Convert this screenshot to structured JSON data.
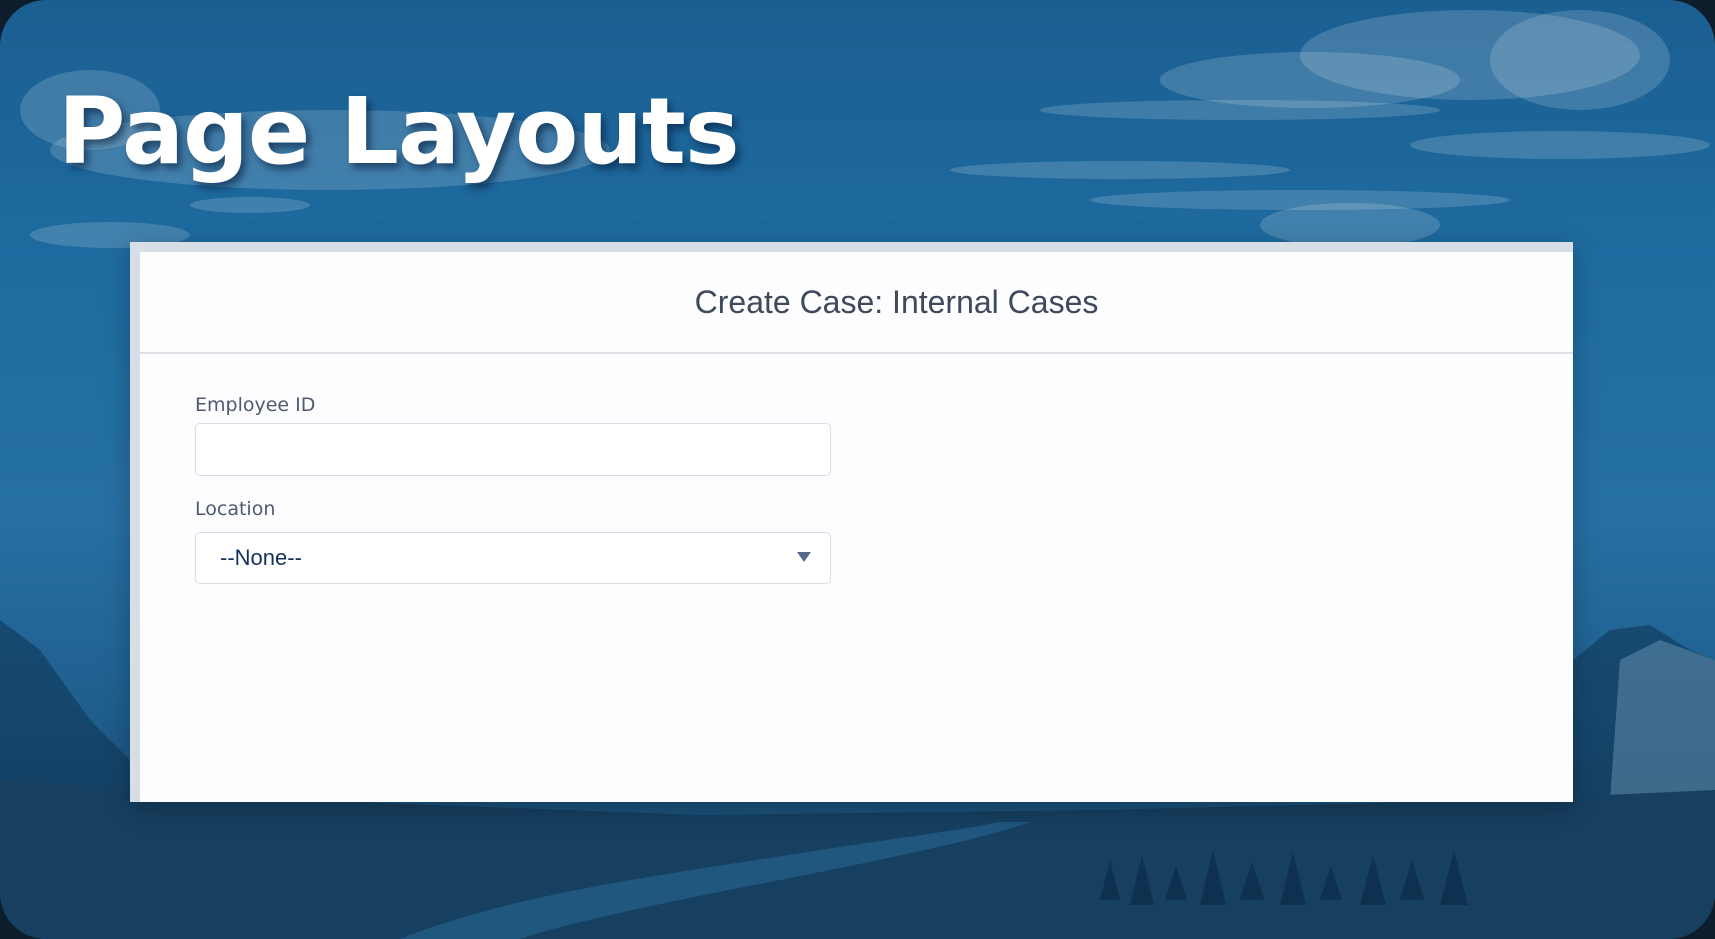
{
  "slide": {
    "title": "Page Layouts"
  },
  "modal": {
    "heading": "Create Case: Internal Cases"
  },
  "fields": {
    "employee_id": {
      "label": "Employee ID",
      "value": "",
      "placeholder": ""
    },
    "location": {
      "label": "Location",
      "selected": "--None--"
    }
  },
  "colors": {
    "sky": "#1e6ba0",
    "title_text": "#ffffff",
    "modal_background": "#fdfcfe",
    "heading_text": "#3e4a5c",
    "label_text": "#4f5b70",
    "input_border": "#d8dde6",
    "value_text": "#16325c"
  }
}
